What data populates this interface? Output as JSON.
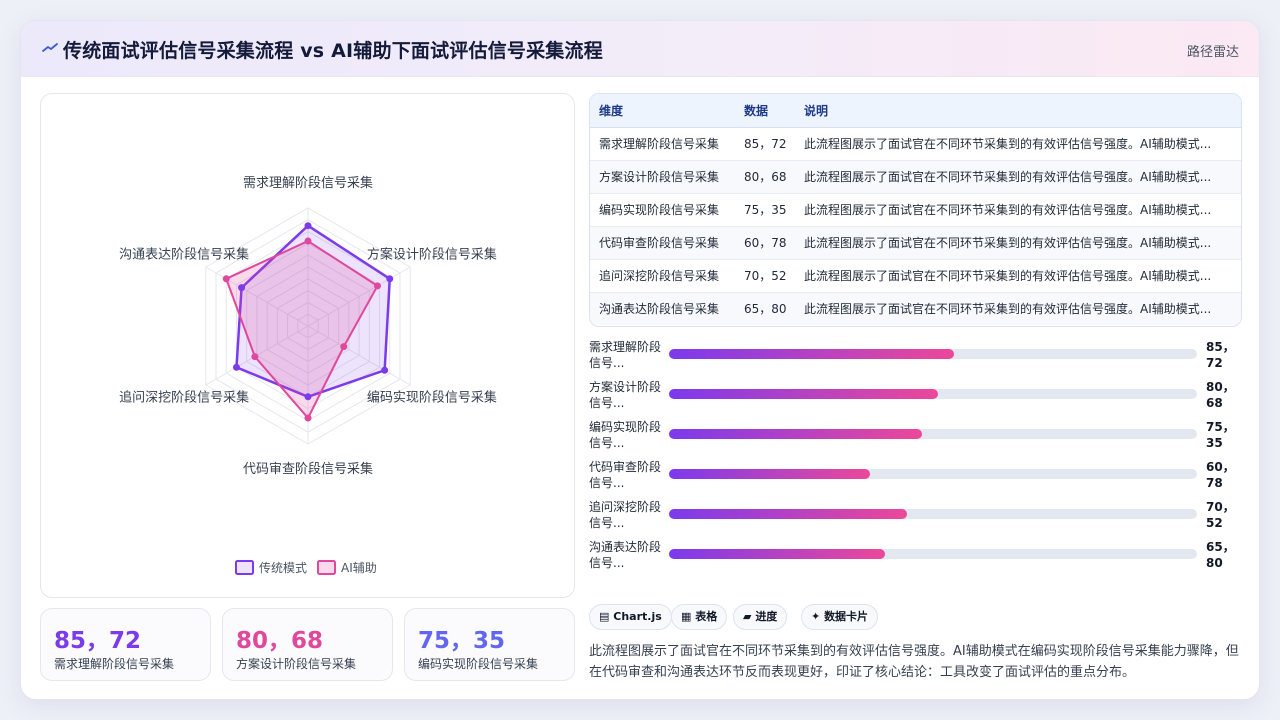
{
  "header": {
    "title": "传统面试评估信号采集流程 vs AI辅助下面试评估信号采集流程",
    "route": "路径雷达",
    "logo_icon": "radar-wave-icon"
  },
  "colors": {
    "series1": "#7c3aed",
    "series2": "#e0489d",
    "bar_start": "#7c3aed",
    "bar_end": "#ec4899"
  },
  "chart_data": {
    "type": "radar",
    "categories": [
      "需求理解阶段信号采集",
      "方案设计阶段信号采集",
      "编码实现阶段信号采集",
      "代码审查阶段信号采集",
      "追问深挖阶段信号采集",
      "沟通表达阶段信号采集"
    ],
    "series": [
      {
        "name": "传统模式",
        "values": [
          85,
          80,
          75,
          60,
          70,
          65
        ]
      },
      {
        "name": "AI辅助",
        "values": [
          72,
          68,
          35,
          78,
          52,
          80
        ]
      }
    ],
    "rlim": [
      0,
      100
    ],
    "grid": true,
    "legend_position": "bottom"
  },
  "stats": [
    {
      "value": "85，72",
      "label": "需求理解阶段信号采集",
      "color": "#7c3aed"
    },
    {
      "value": "80，68",
      "label": "方案设计阶段信号采集",
      "color": "#e0489d"
    },
    {
      "value": "75，35",
      "label": "编码实现阶段信号采集",
      "color": "#6366f1"
    }
  ],
  "table": {
    "headers": [
      "维度",
      "数据",
      "说明"
    ],
    "rows": [
      [
        "需求理解阶段信号采集",
        "85，72",
        "此流程图展示了面试官在不同环节采集到的有效评估信号强度。AI辅助模式..."
      ],
      [
        "方案设计阶段信号采集",
        "80，68",
        "此流程图展示了面试官在不同环节采集到的有效评估信号强度。AI辅助模式..."
      ],
      [
        "编码实现阶段信号采集",
        "75，35",
        "此流程图展示了面试官在不同环节采集到的有效评估信号强度。AI辅助模式..."
      ],
      [
        "代码审查阶段信号采集",
        "60，78",
        "此流程图展示了面试官在不同环节采集到的有效评估信号强度。AI辅助模式..."
      ],
      [
        "追问深挖阶段信号采集",
        "70，52",
        "此流程图展示了面试官在不同环节采集到的有效评估信号强度。AI辅助模式..."
      ],
      [
        "沟通表达阶段信号采集",
        "65，80",
        "此流程图展示了面试官在不同环节采集到的有效评估信号强度。AI辅助模式..."
      ]
    ]
  },
  "bars": [
    {
      "label_line1": "需求理解阶段",
      "label_line2": "信号...",
      "value_line1": "85，",
      "value_line2": "72",
      "progress": 0.54
    },
    {
      "label_line1": "方案设计阶段",
      "label_line2": "信号...",
      "value_line1": "80，",
      "value_line2": "68",
      "progress": 0.51
    },
    {
      "label_line1": "编码实现阶段",
      "label_line2": "信号...",
      "value_line1": "75，",
      "value_line2": "35",
      "progress": 0.48
    },
    {
      "label_line1": "代码审查阶段",
      "label_line2": "信号...",
      "value_line1": "60，",
      "value_line2": "78",
      "progress": 0.38
    },
    {
      "label_line1": "追问深挖阶段",
      "label_line2": "信号...",
      "value_line1": "70，",
      "value_line2": "52",
      "progress": 0.45
    },
    {
      "label_line1": "沟通表达阶段",
      "label_line2": "信号...",
      "value_line1": "65，",
      "value_line2": "80",
      "progress": 0.41
    }
  ],
  "chips": [
    {
      "icon": "▤",
      "label": "Chart.js",
      "icon_name": "chart-icon"
    },
    {
      "icon": "▦",
      "label": "表格",
      "icon_name": "table-icon"
    },
    {
      "icon": "▰",
      "label": "进度",
      "icon_name": "progress-icon"
    },
    {
      "icon": "✦",
      "label": "数据卡片",
      "icon_name": "sparkle-icon"
    }
  ],
  "description": "此流程图展示了面试官在不同环节采集到的有效评估信号强度。AI辅助模式在编码实现阶段信号采集能力骤降，但在代码审查和沟通表达环节反而表现更好，印证了核心结论：工具改变了面试评估的重点分布。"
}
